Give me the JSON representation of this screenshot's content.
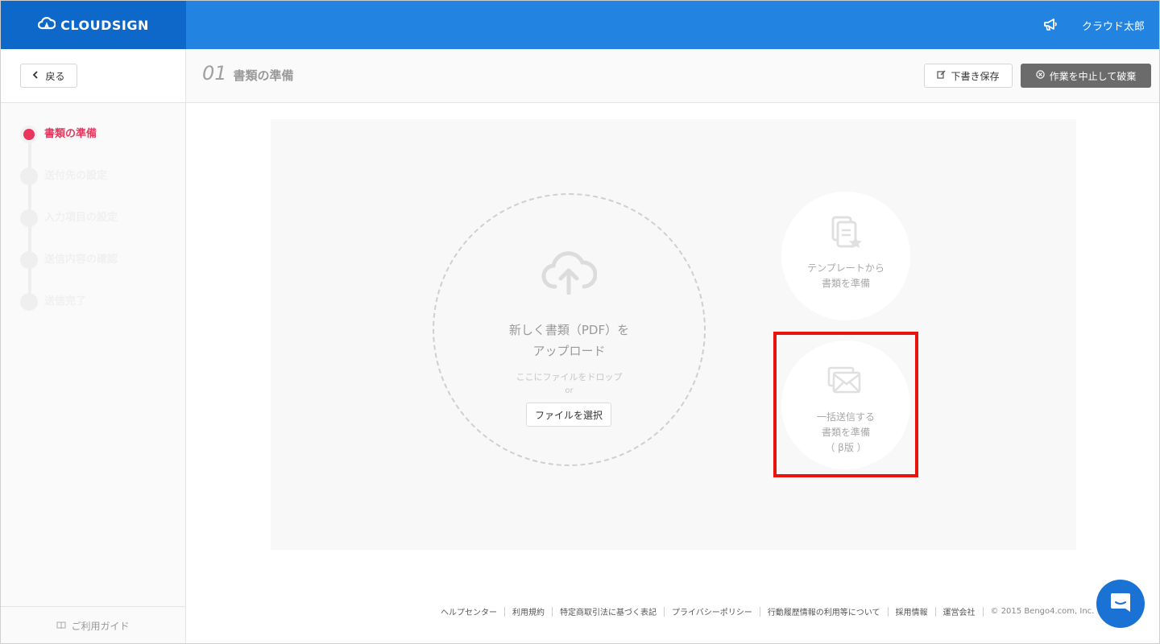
{
  "header": {
    "brand": "CLOUDSIGN",
    "user_name": "クラウド太郎"
  },
  "subheader": {
    "back_label": "戻る",
    "step_number": "01",
    "step_title": "書類の準備",
    "draft_label": "下書き保存",
    "abort_label": "作業を中止して破棄"
  },
  "sidebar": {
    "steps": [
      {
        "label": "書類の準備",
        "active": true
      },
      {
        "label": "送付先の設定",
        "active": false
      },
      {
        "label": "入力項目の設定",
        "active": false
      },
      {
        "label": "送信内容の確認",
        "active": false
      },
      {
        "label": "送信完了",
        "active": false
      }
    ],
    "guide_label": "ご利用ガイド"
  },
  "main": {
    "upload": {
      "title_line1": "新しく書類（PDF）を",
      "title_line2": "アップロード",
      "drop_text": "ここにファイルをドロップ",
      "or_text": "or",
      "select_label": "ファイルを選択"
    },
    "template_card": {
      "line1": "テンプレートから",
      "line2": "書類を準備"
    },
    "bulk_card": {
      "line1": "一括送信する",
      "line2": "書類を準備",
      "line3": "（ β版 ）"
    }
  },
  "footer": {
    "links": [
      "ヘルプセンター",
      "利用規約",
      "特定商取引法に基づく表記",
      "プライバシーポリシー",
      "行動履歴情報の利用等について",
      "採用情報",
      "運営会社"
    ],
    "copyright": "© 2015 Bengo4.com, Inc."
  },
  "colors": {
    "header_blue": "#2284e0",
    "brand_blue": "#0d68c9",
    "active_step": "#e8365e",
    "highlight_red": "#e8150f",
    "chat_blue": "#1a73d4"
  }
}
